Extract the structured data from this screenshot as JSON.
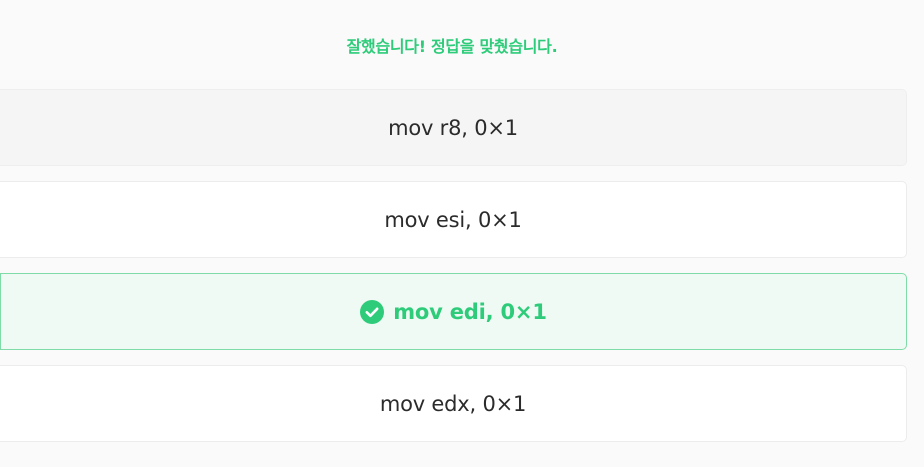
{
  "feedback": {
    "message": "잘했습니다! 정답을 맞췄습니다."
  },
  "options": [
    {
      "label": "mov r8, 0×1",
      "state": "hovered"
    },
    {
      "label": "mov esi, 0×1",
      "state": "default"
    },
    {
      "label": "mov edi, 0×1",
      "state": "correct",
      "icon": "check-circle-icon"
    },
    {
      "label": "mov edx, 0×1",
      "state": "default"
    }
  ],
  "colors": {
    "success": "#2ecc7a",
    "success_background": "#eefaf3",
    "success_border": "#7fdca8",
    "option_text": "#2b2b2b",
    "hovered_background": "#f5f5f5"
  }
}
